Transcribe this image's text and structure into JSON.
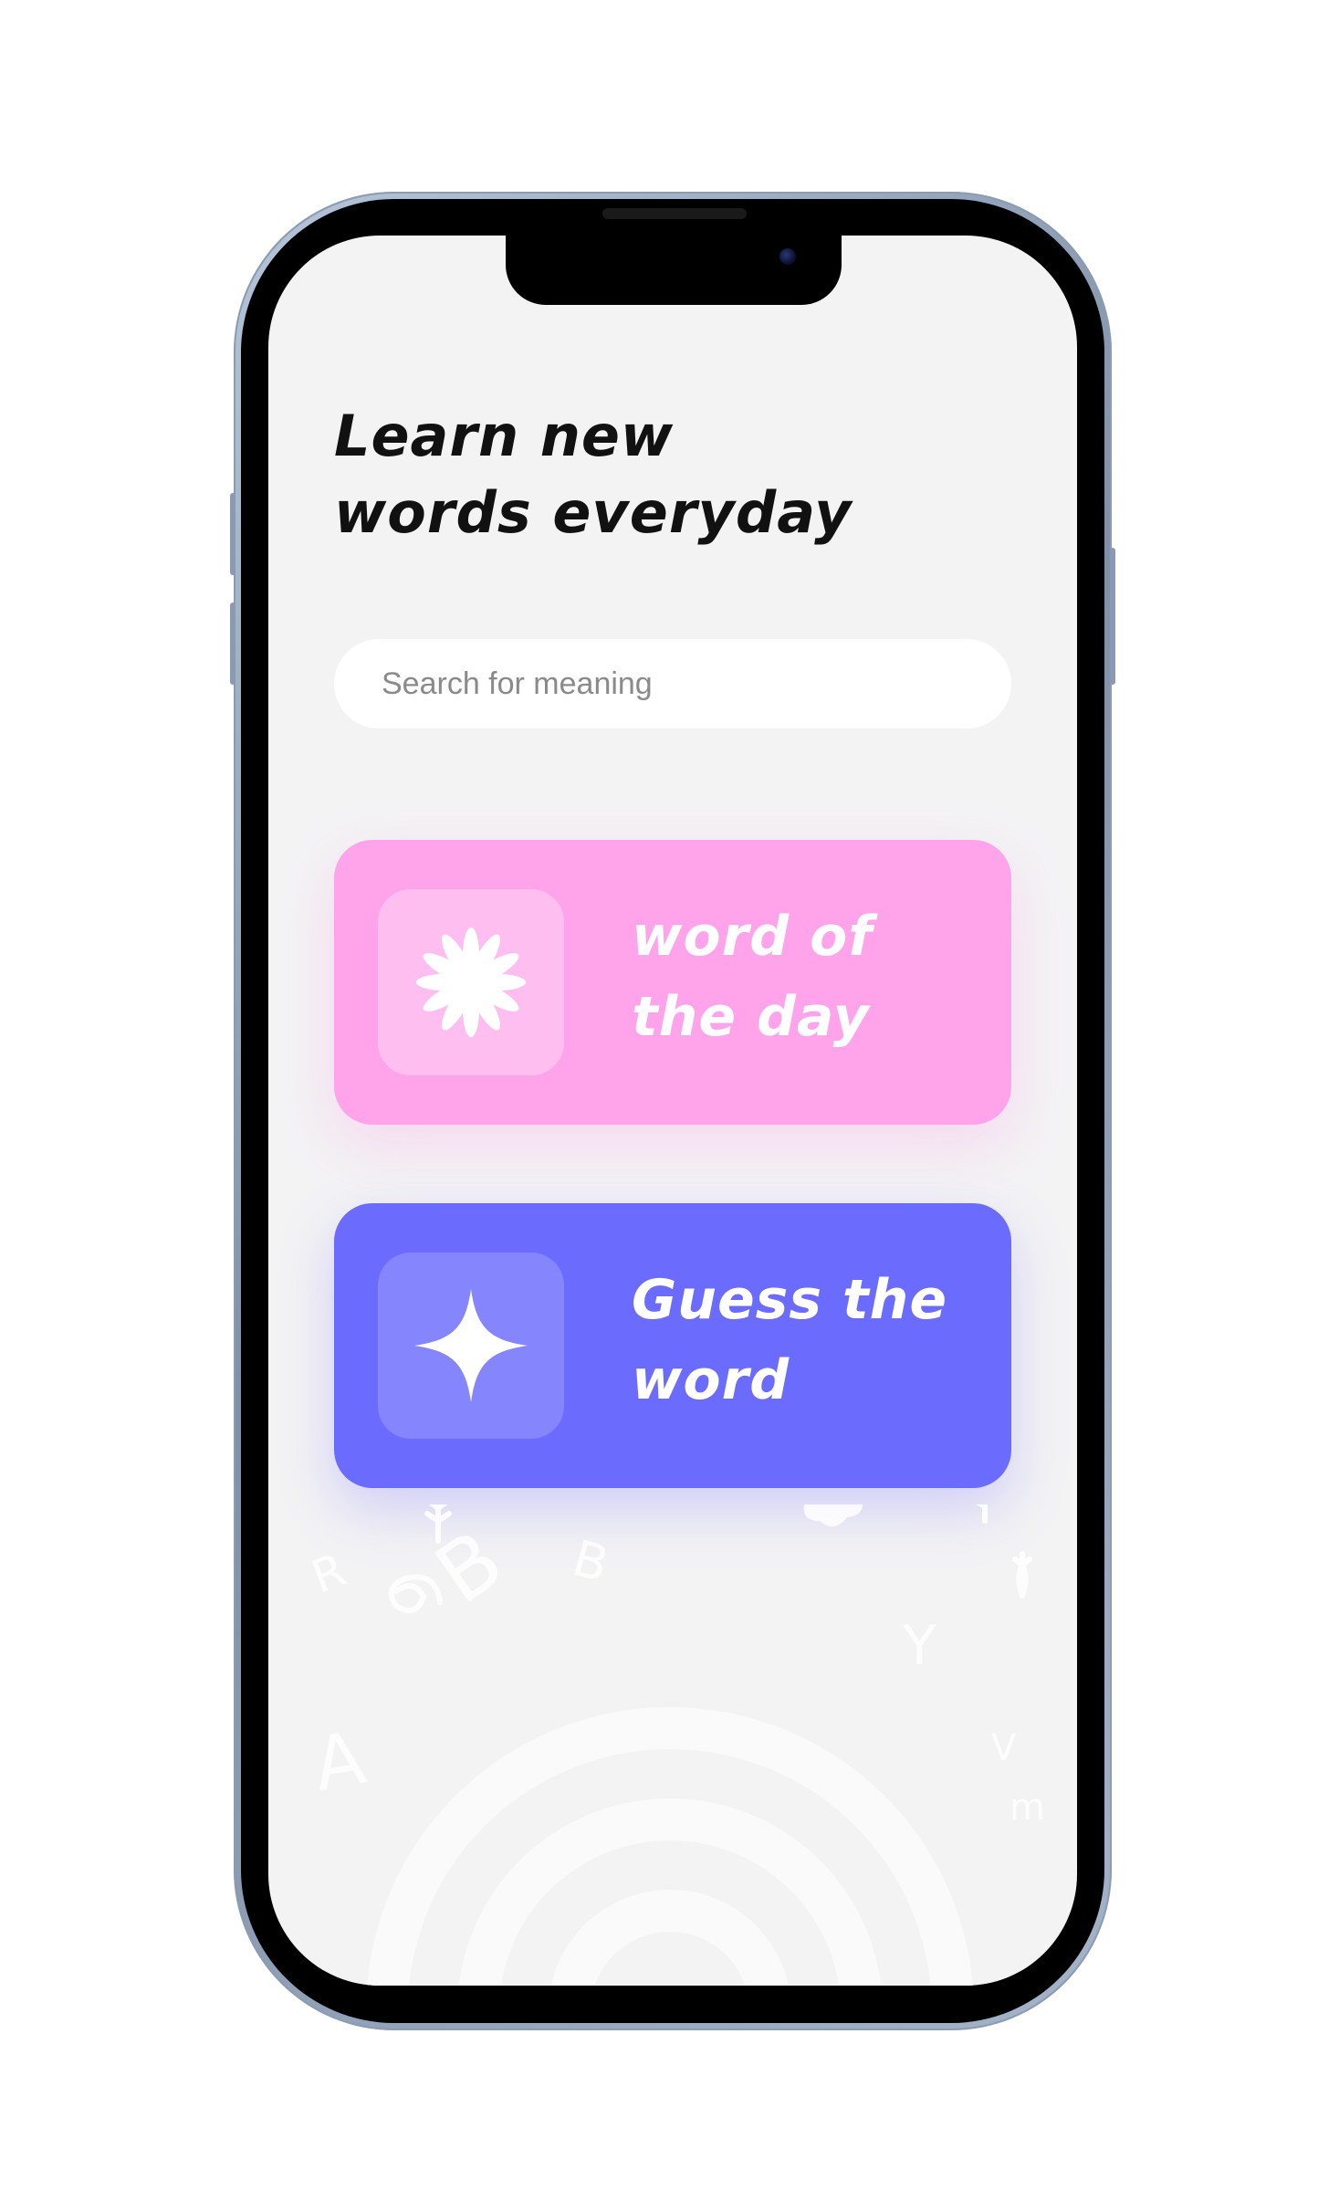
{
  "header": {
    "title": "Learn new\nwords everyday"
  },
  "search": {
    "placeholder": "Search for meaning",
    "value": ""
  },
  "cards": [
    {
      "label": "word of\nthe day",
      "icon": "flower-icon",
      "color": "#ffa3ea"
    },
    {
      "label": "Guess the\nword",
      "icon": "sparkle-icon",
      "color": "#6b6bfd"
    }
  ],
  "decor": {
    "letters": [
      "R",
      "B",
      "m",
      "B",
      "Y",
      "A",
      "V",
      "m"
    ]
  },
  "colors": {
    "screen_background": "#f3f3f4",
    "title_text": "#111111"
  }
}
